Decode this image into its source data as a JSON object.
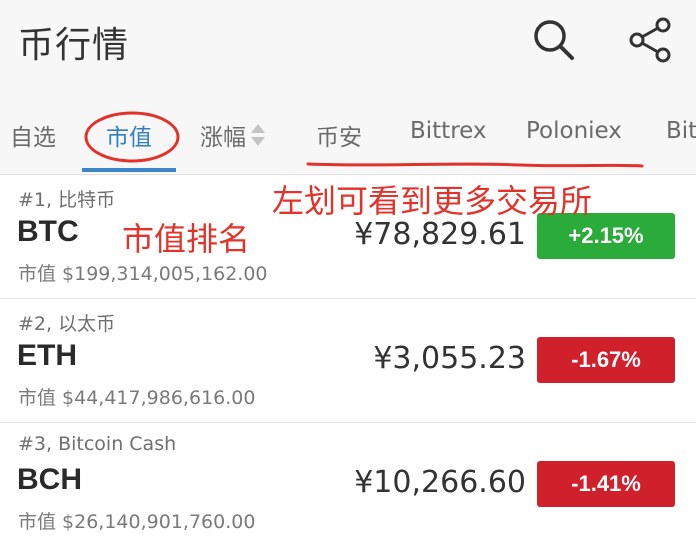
{
  "header": {
    "title": "币行情",
    "search_icon": "search-icon",
    "share_icon": "share-icon"
  },
  "tabs": [
    {
      "label": "自选",
      "active": false
    },
    {
      "label": "市值",
      "active": true
    },
    {
      "label": "涨幅",
      "active": false,
      "sortable": true
    },
    {
      "label": "币安",
      "active": false
    },
    {
      "label": "Bittrex",
      "active": false
    },
    {
      "label": "Poloniex",
      "active": false
    },
    {
      "label": "Bitf",
      "active": false
    }
  ],
  "annotations": {
    "swipe_hint": "左划可看到更多交易所",
    "rank_hint": "市值排名",
    "color": "#e2322a"
  },
  "colors": {
    "accent": "#2f7fc4",
    "up": "#2bab3a",
    "down": "#d0202b"
  },
  "coins": [
    {
      "rank_label": "#1, 比特币",
      "symbol": "BTC",
      "market_cap": "市值 $199,314,005,162.00",
      "price": "¥78,829.61",
      "change": "+2.15%",
      "direction": "up"
    },
    {
      "rank_label": "#2, 以太币",
      "symbol": "ETH",
      "market_cap": "市值 $44,417,986,616.00",
      "price": "¥3,055.23",
      "change": "-1.67%",
      "direction": "down"
    },
    {
      "rank_label": "#3, Bitcoin Cash",
      "symbol": "BCH",
      "market_cap": "市值 $26,140,901,760.00",
      "price": "¥10,266.60",
      "change": "-1.41%",
      "direction": "down"
    }
  ]
}
